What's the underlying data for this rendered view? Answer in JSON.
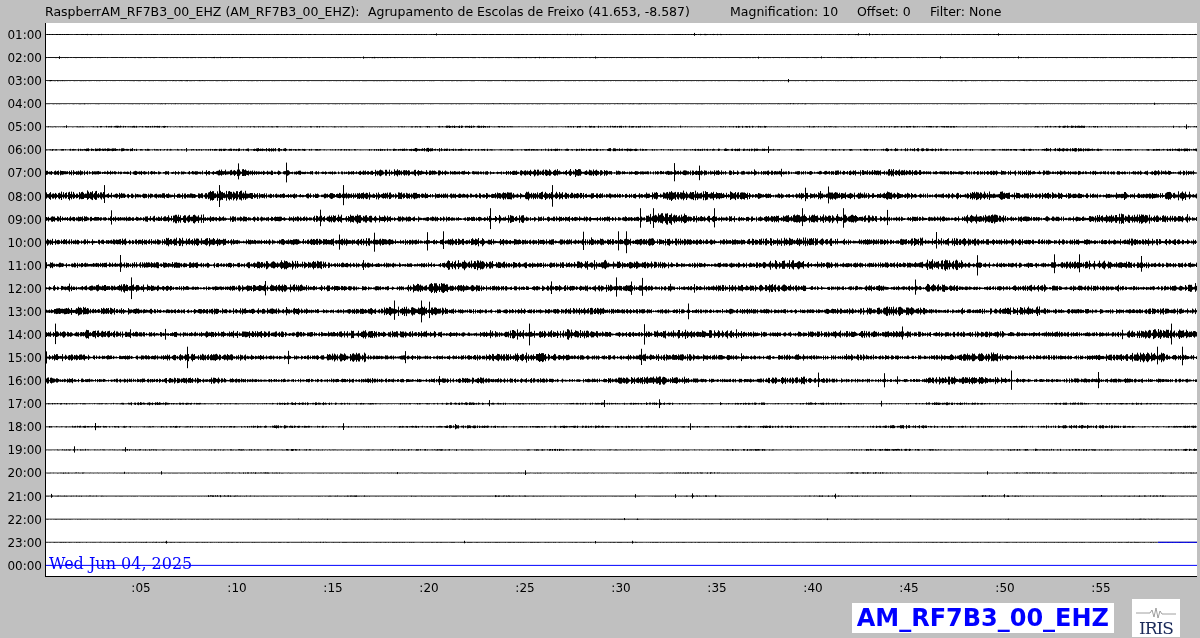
{
  "header": {
    "station": "RaspberrAM_RF7B3_00_EHZ (AM_RF7B3_00_EHZ):",
    "location": "Agrupamento de Escolas de Freixo (41.653, -8.587)",
    "magnification": "Magnification: 10",
    "offset": "Offset: 0",
    "filter": "Filter: None"
  },
  "hours": [
    "01:00",
    "02:00",
    "03:00",
    "04:00",
    "05:00",
    "06:00",
    "07:00",
    "08:00",
    "09:00",
    "10:00",
    "11:00",
    "12:00",
    "13:00",
    "14:00",
    "15:00",
    "16:00",
    "17:00",
    "18:00",
    "19:00",
    "20:00",
    "21:00",
    "22:00",
    "23:00",
    "00:00"
  ],
  "minute_ticks": [
    ":05",
    ":10",
    ":15",
    ":20",
    ":25",
    ":30",
    ":35",
    ":40",
    ":45",
    ":50",
    ":55"
  ],
  "date": "Wed Jun 04, 2025",
  "channel_label": "AM_RF7B3_00_EHZ",
  "logo_text": "IRIS"
}
